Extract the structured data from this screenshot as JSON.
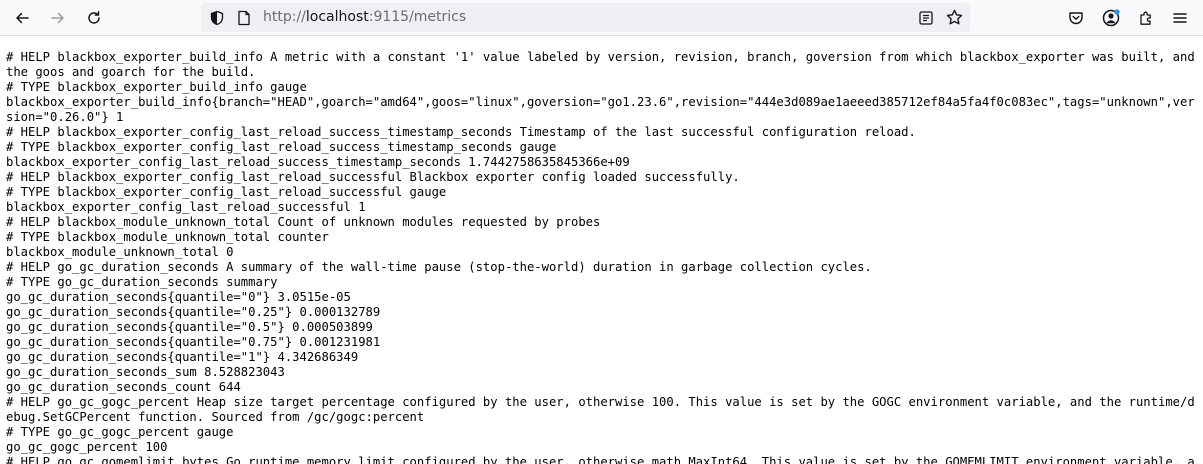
{
  "browser": {
    "url_scheme": "http://",
    "url_host": "localhost",
    "url_rest": ":9115/metrics",
    "toolbar_icons": [
      "back-icon",
      "forward-icon",
      "reload-icon",
      "shield-icon",
      "page-icon",
      "reader-mode-icon",
      "bookmark-star-icon",
      "pocket-icon",
      "account-icon",
      "extensions-icon",
      "menu-icon"
    ]
  },
  "metrics_lines": [
    "# HELP blackbox_exporter_build_info A metric with a constant '1' value labeled by version, revision, branch, goversion from which blackbox_exporter was built, and the goos and goarch for the build.",
    "# TYPE blackbox_exporter_build_info gauge",
    "blackbox_exporter_build_info{branch=\"HEAD\",goarch=\"amd64\",goos=\"linux\",goversion=\"go1.23.6\",revision=\"444e3d089ae1aeeed385712ef84a5fa4f0c083ec\",tags=\"unknown\",version=\"0.26.0\"} 1",
    "# HELP blackbox_exporter_config_last_reload_success_timestamp_seconds Timestamp of the last successful configuration reload.",
    "# TYPE blackbox_exporter_config_last_reload_success_timestamp_seconds gauge",
    "blackbox_exporter_config_last_reload_success_timestamp_seconds 1.7442758635845366e+09",
    "# HELP blackbox_exporter_config_last_reload_successful Blackbox exporter config loaded successfully.",
    "# TYPE blackbox_exporter_config_last_reload_successful gauge",
    "blackbox_exporter_config_last_reload_successful 1",
    "# HELP blackbox_module_unknown_total Count of unknown modules requested by probes",
    "# TYPE blackbox_module_unknown_total counter",
    "blackbox_module_unknown_total 0",
    "# HELP go_gc_duration_seconds A summary of the wall-time pause (stop-the-world) duration in garbage collection cycles.",
    "# TYPE go_gc_duration_seconds summary",
    "go_gc_duration_seconds{quantile=\"0\"} 3.0515e-05",
    "go_gc_duration_seconds{quantile=\"0.25\"} 0.000132789",
    "go_gc_duration_seconds{quantile=\"0.5\"} 0.000503899",
    "go_gc_duration_seconds{quantile=\"0.75\"} 0.001231981",
    "go_gc_duration_seconds{quantile=\"1\"} 4.342686349",
    "go_gc_duration_seconds_sum 8.528823043",
    "go_gc_duration_seconds_count 644",
    "# HELP go_gc_gogc_percent Heap size target percentage configured by the user, otherwise 100. This value is set by the GOGC environment variable, and the runtime/debug.SetGCPercent function. Sourced from /gc/gogc:percent",
    "# TYPE go_gc_gogc_percent gauge",
    "go_gc_gogc_percent 100",
    "# HELP go_gc_gomemlimit_bytes Go runtime memory limit configured by the user, otherwise math.MaxInt64. This value is set by the GOMEMLIMIT environment variable, and"
  ]
}
